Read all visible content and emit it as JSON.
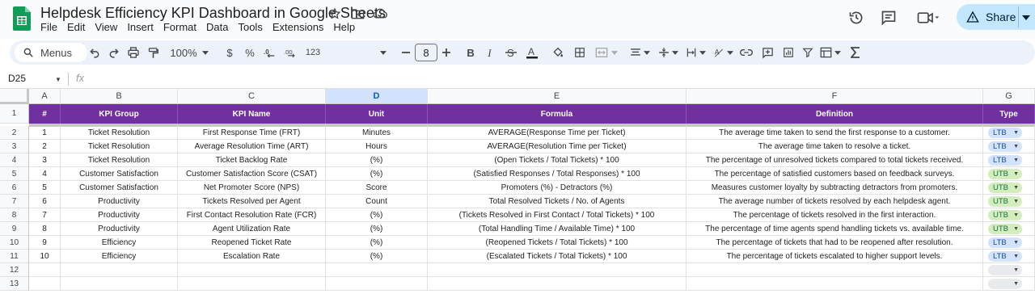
{
  "app": {
    "doc_title": "Helpdesk Efficiency KPI Dashboard in Google Sheets",
    "menu": [
      "File",
      "Edit",
      "View",
      "Insert",
      "Format",
      "Data",
      "Tools",
      "Extensions",
      "Help"
    ],
    "share_label": "Share"
  },
  "toolbar": {
    "menus_label": "Menus",
    "zoom": "100%",
    "currency": "$",
    "percent": "%",
    "number_format": "123",
    "font_size": "8"
  },
  "formula_bar": {
    "name_box": "D25",
    "fx": "fx"
  },
  "sheet": {
    "columns": [
      "A",
      "B",
      "C",
      "D",
      "E",
      "F",
      "G"
    ],
    "selected_column": "D",
    "row_numbers": [
      "1",
      "2",
      "3",
      "4",
      "5",
      "6",
      "7",
      "8",
      "9",
      "10",
      "11",
      "12",
      "13"
    ],
    "header": [
      "#",
      "KPI Group",
      "KPI Name",
      "Unit",
      "Formula",
      "Definition",
      "Type"
    ],
    "rows": [
      [
        "1",
        "Ticket Resolution",
        "First Response Time (FRT)",
        "Minutes",
        "AVERAGE(Response Time per Ticket)",
        "The average time taken to send the first response to a customer.",
        "LTB"
      ],
      [
        "2",
        "Ticket Resolution",
        "Average Resolution Time (ART)",
        "Hours",
        "AVERAGE(Resolution Time per Ticket)",
        "The average time taken to resolve a ticket.",
        "LTB"
      ],
      [
        "3",
        "Ticket Resolution",
        "Ticket Backlog Rate",
        "(%)",
        "(Open Tickets / Total Tickets) * 100",
        "The percentage of unresolved tickets compared to total tickets received.",
        "LTB"
      ],
      [
        "4",
        "Customer Satisfaction",
        "Customer Satisfaction Score (CSAT)",
        "(%)",
        "(Satisfied Responses / Total Responses) * 100",
        "The percentage of satisfied customers based on feedback surveys.",
        "UTB"
      ],
      [
        "5",
        "Customer Satisfaction",
        "Net Promoter Score (NPS)",
        "Score",
        "Promoters (%) - Detractors (%)",
        "Measures customer loyalty by subtracting detractors from promoters.",
        "UTB"
      ],
      [
        "6",
        "Productivity",
        "Tickets Resolved per Agent",
        "Count",
        "Total Resolved Tickets / No. of Agents",
        "The average number of tickets resolved by each helpdesk agent.",
        "UTB"
      ],
      [
        "7",
        "Productivity",
        "First Contact Resolution Rate (FCR)",
        "(%)",
        "(Tickets Resolved in First Contact / Total Tickets) * 100",
        "The percentage of tickets resolved in the first interaction.",
        "UTB"
      ],
      [
        "8",
        "Productivity",
        "Agent Utilization Rate",
        "(%)",
        "(Total Handling Time / Available Time) * 100",
        "The percentage of time agents spend handling tickets vs. available time.",
        "UTB"
      ],
      [
        "9",
        "Efficiency",
        "Reopened Ticket Rate",
        "(%)",
        "(Reopened Tickets / Total Tickets) * 100",
        "The percentage of tickets that had to be reopened after resolution.",
        "LTB"
      ],
      [
        "10",
        "Efficiency",
        "Escalation Rate",
        "(%)",
        "(Escalated Tickets / Total Tickets) * 100",
        "The percentage of tickets escalated to higher support levels.",
        "LTB"
      ]
    ]
  },
  "colors": {
    "header_bg": "#7030a0",
    "ltb_chip": "#d3e3fd",
    "utb_chip": "#d4edbc",
    "share_bg": "#c2e7ff"
  }
}
